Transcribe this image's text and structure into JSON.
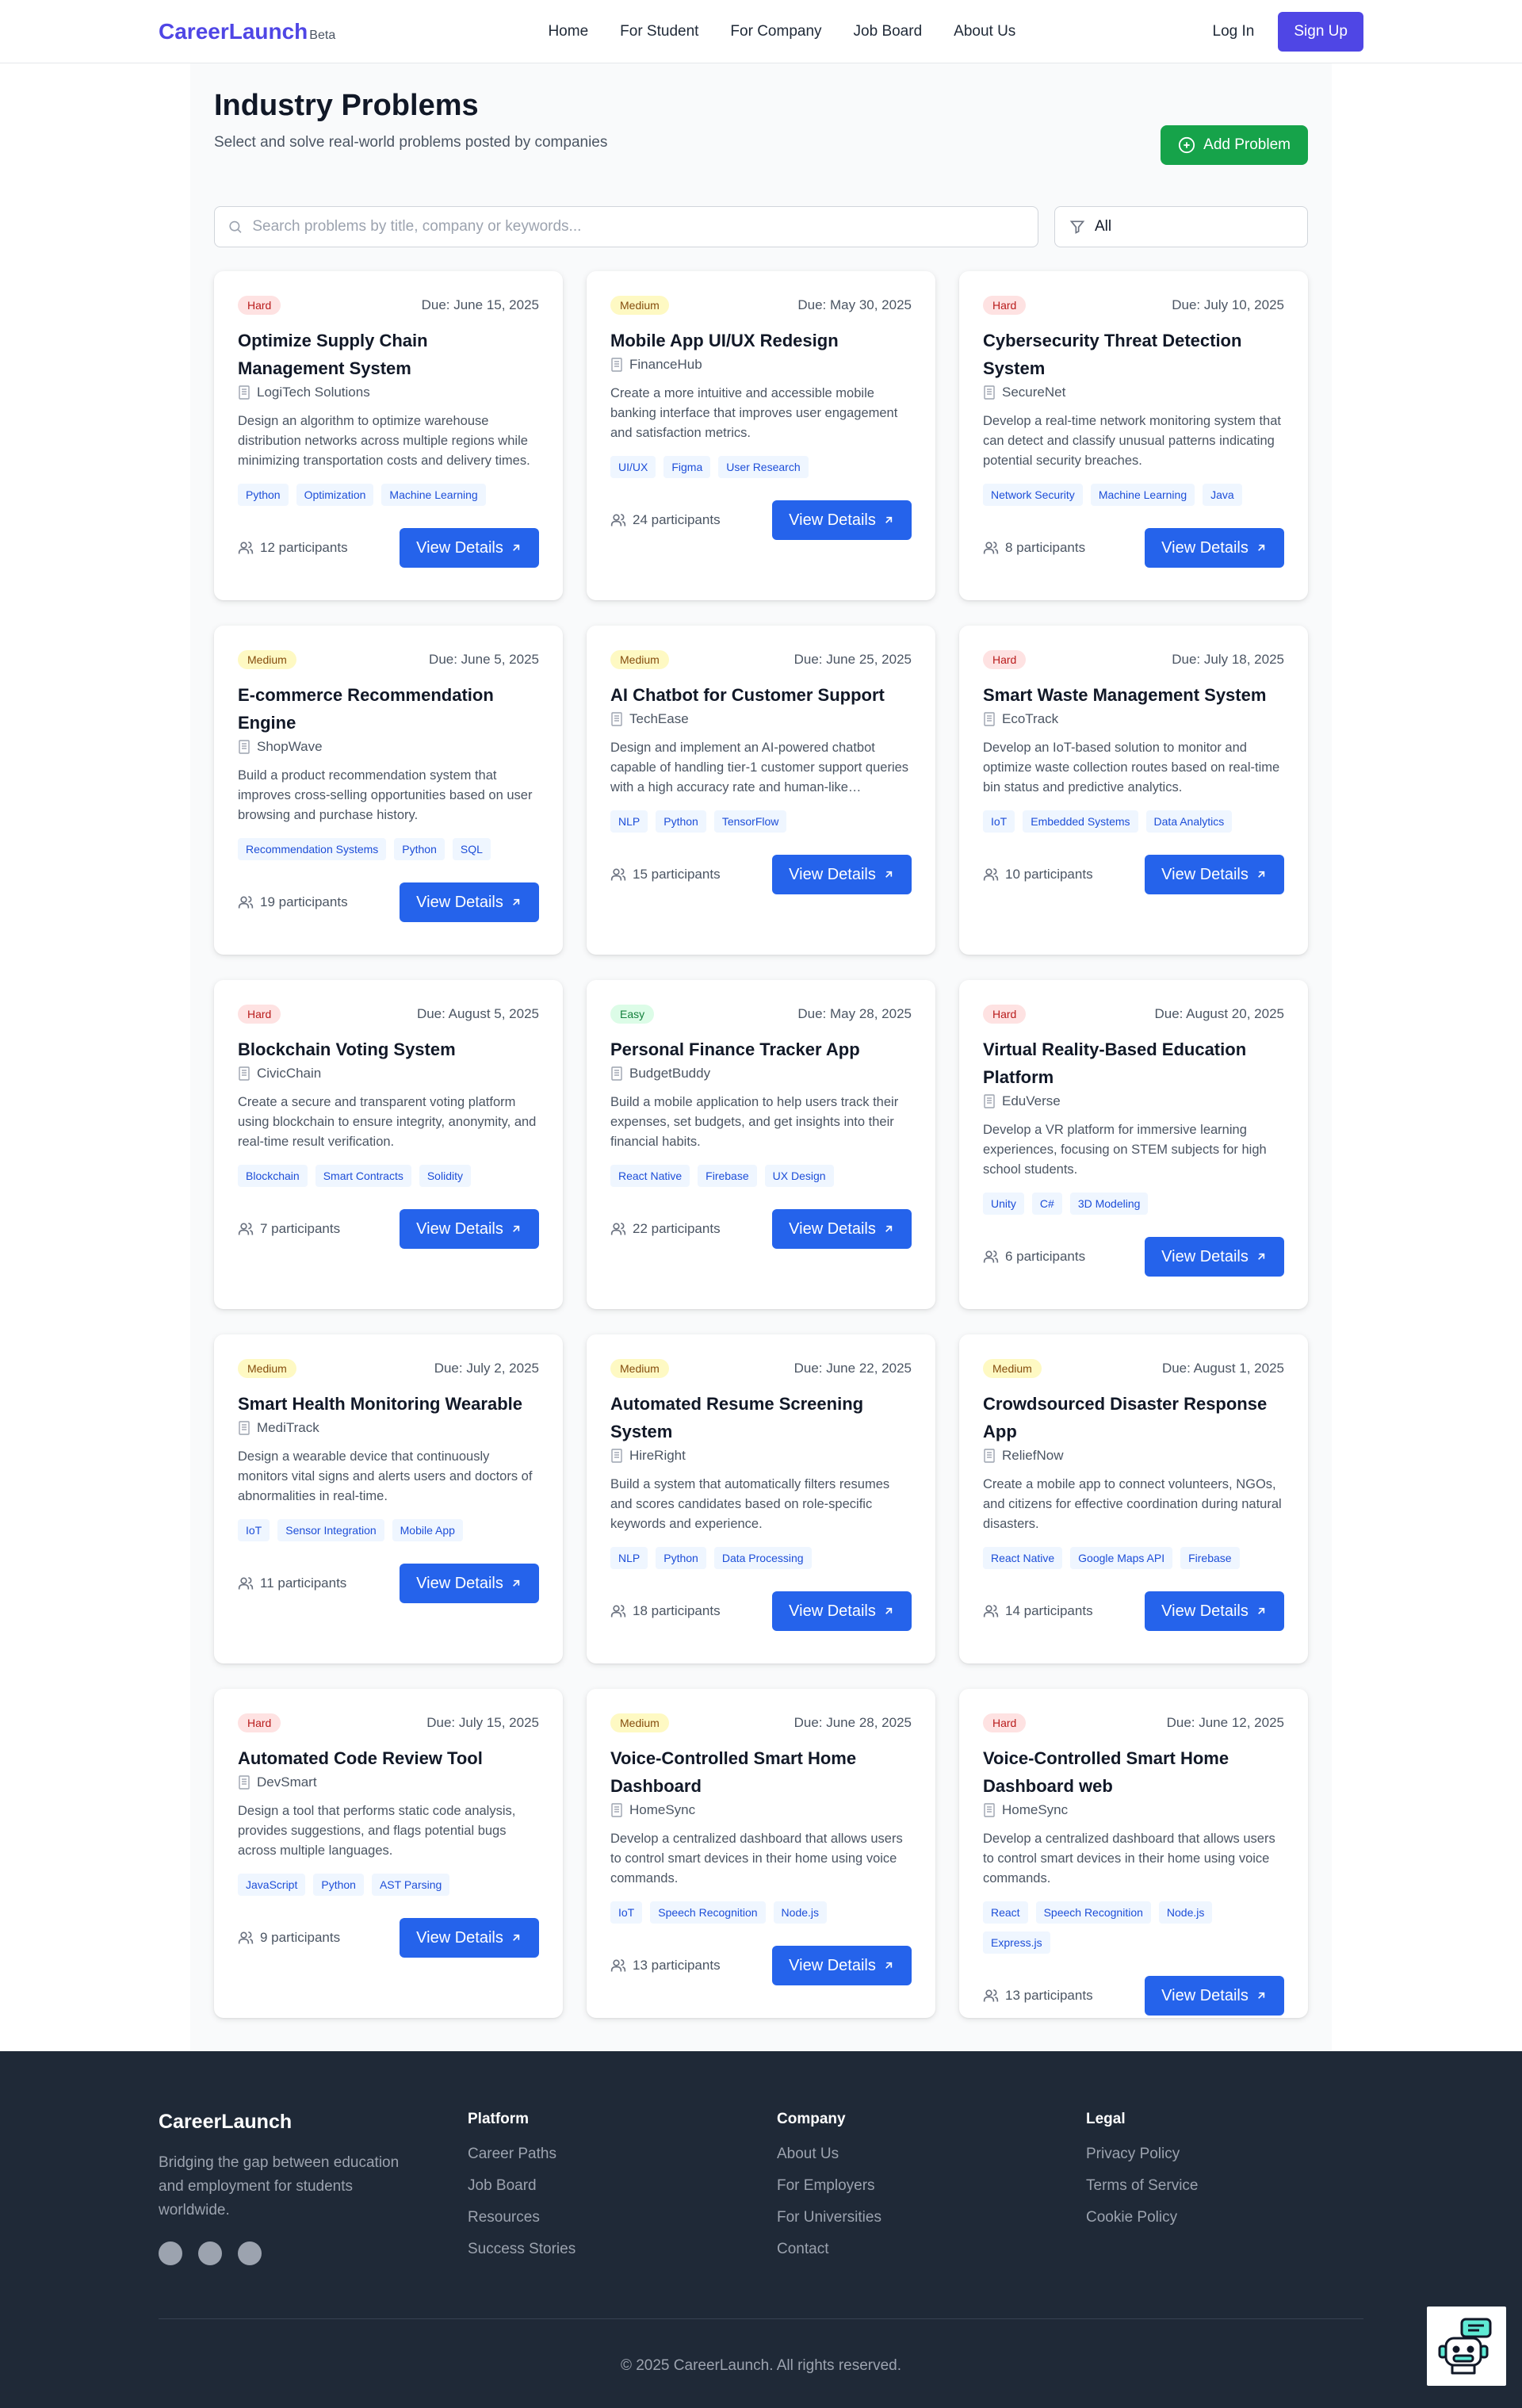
{
  "nav": {
    "brand": "CareerLaunch",
    "beta": "Beta",
    "links": [
      "Home",
      "For Student",
      "For Company",
      "Job Board",
      "About Us"
    ],
    "login": "Log In",
    "signup": "Sign Up"
  },
  "header": {
    "title": "Industry Problems",
    "subtitle": "Select and solve real-world problems posted by companies",
    "add_button": "Add Problem"
  },
  "search": {
    "placeholder": "Search problems by title, company or keywords...",
    "filter_value": "All"
  },
  "problems": [
    {
      "difficulty": "Hard",
      "due": "Due: June 15, 2025",
      "title": "Optimize Supply Chain Management System",
      "company": "LogiTech Solutions",
      "description": "Design an algorithm to optimize warehouse distribution networks across multiple regions while minimizing transportation costs and delivery times.",
      "tags": [
        "Python",
        "Optimization",
        "Machine Learning"
      ],
      "participants": "12 participants"
    },
    {
      "difficulty": "Medium",
      "due": "Due: May 30, 2025",
      "title": "Mobile App UI/UX Redesign",
      "company": "FinanceHub",
      "description": "Create a more intuitive and accessible mobile banking interface that improves user engagement and satisfaction metrics.",
      "tags": [
        "UI/UX",
        "Figma",
        "User Research"
      ],
      "participants": "24 participants"
    },
    {
      "difficulty": "Hard",
      "due": "Due: July 10, 2025",
      "title": "Cybersecurity Threat Detection System",
      "company": "SecureNet",
      "description": "Develop a real-time network monitoring system that can detect and classify unusual patterns indicating potential security breaches.",
      "tags": [
        "Network Security",
        "Machine Learning",
        "Java"
      ],
      "participants": "8 participants"
    },
    {
      "difficulty": "Medium",
      "due": "Due: June 5, 2025",
      "title": "E-commerce Recommendation Engine",
      "company": "ShopWave",
      "description": "Build a product recommendation system that improves cross-selling opportunities based on user browsing and purchase history.",
      "tags": [
        "Recommendation Systems",
        "Python",
        "SQL"
      ],
      "participants": "19 participants"
    },
    {
      "difficulty": "Medium",
      "due": "Due: June 25, 2025",
      "title": "AI Chatbot for Customer Support",
      "company": "TechEase",
      "description": "Design and implement an AI-powered chatbot capable of handling tier-1 customer support queries with a high accuracy rate and human-like responses.",
      "tags": [
        "NLP",
        "Python",
        "TensorFlow"
      ],
      "participants": "15 participants"
    },
    {
      "difficulty": "Hard",
      "due": "Due: July 18, 2025",
      "title": "Smart Waste Management System",
      "company": "EcoTrack",
      "description": "Develop an IoT-based solution to monitor and optimize waste collection routes based on real-time bin status and predictive analytics.",
      "tags": [
        "IoT",
        "Embedded Systems",
        "Data Analytics"
      ],
      "participants": "10 participants"
    },
    {
      "difficulty": "Hard",
      "due": "Due: August 5, 2025",
      "title": "Blockchain Voting System",
      "company": "CivicChain",
      "description": "Create a secure and transparent voting platform using blockchain to ensure integrity, anonymity, and real-time result verification.",
      "tags": [
        "Blockchain",
        "Smart Contracts",
        "Solidity"
      ],
      "participants": "7 participants"
    },
    {
      "difficulty": "Easy",
      "due": "Due: May 28, 2025",
      "title": "Personal Finance Tracker App",
      "company": "BudgetBuddy",
      "description": "Build a mobile application to help users track their expenses, set budgets, and get insights into their financial habits.",
      "tags": [
        "React Native",
        "Firebase",
        "UX Design"
      ],
      "participants": "22 participants"
    },
    {
      "difficulty": "Hard",
      "due": "Due: August 20, 2025",
      "title": "Virtual Reality-Based Education Platform",
      "company": "EduVerse",
      "description": "Develop a VR platform for immersive learning experiences, focusing on STEM subjects for high school students.",
      "tags": [
        "Unity",
        "C#",
        "3D Modeling"
      ],
      "participants": "6 participants"
    },
    {
      "difficulty": "Medium",
      "due": "Due: July 2, 2025",
      "title": "Smart Health Monitoring Wearable",
      "company": "MediTrack",
      "description": "Design a wearable device that continuously monitors vital signs and alerts users and doctors of abnormalities in real-time.",
      "tags": [
        "IoT",
        "Sensor Integration",
        "Mobile App"
      ],
      "participants": "11 participants"
    },
    {
      "difficulty": "Medium",
      "due": "Due: June 22, 2025",
      "title": "Automated Resume Screening System",
      "company": "HireRight",
      "description": "Build a system that automatically filters resumes and scores candidates based on role-specific keywords and experience.",
      "tags": [
        "NLP",
        "Python",
        "Data Processing"
      ],
      "participants": "18 participants"
    },
    {
      "difficulty": "Medium",
      "due": "Due: August 1, 2025",
      "title": "Crowdsourced Disaster Response App",
      "company": "ReliefNow",
      "description": "Create a mobile app to connect volunteers, NGOs, and citizens for effective coordination during natural disasters.",
      "tags": [
        "React Native",
        "Google Maps API",
        "Firebase"
      ],
      "participants": "14 participants"
    },
    {
      "difficulty": "Hard",
      "due": "Due: July 15, 2025",
      "title": "Automated Code Review Tool",
      "company": "DevSmart",
      "description": "Design a tool that performs static code analysis, provides suggestions, and flags potential bugs across multiple languages.",
      "tags": [
        "JavaScript",
        "Python",
        "AST Parsing"
      ],
      "participants": "9 participants"
    },
    {
      "difficulty": "Medium",
      "due": "Due: June 28, 2025",
      "title": "Voice-Controlled Smart Home Dashboard",
      "company": "HomeSync",
      "description": "Develop a centralized dashboard that allows users to control smart devices in their home using voice commands.",
      "tags": [
        "IoT",
        "Speech Recognition",
        "Node.js"
      ],
      "participants": "13 participants"
    },
    {
      "difficulty": "Hard",
      "due": "Due: June 12, 2025",
      "title": "Voice-Controlled Smart Home Dashboard web",
      "company": "HomeSync",
      "description": "Develop a centralized dashboard that allows users to control smart devices in their home using voice commands.",
      "tags": [
        "React",
        "Speech Recognition",
        "Node.js",
        "Express.js"
      ],
      "participants": "13 participants"
    }
  ],
  "view_details_label": "View Details",
  "footer": {
    "brand": "CareerLaunch",
    "tagline": "Bridging the gap between education and employment for students worldwide.",
    "platform": {
      "heading": "Platform",
      "links": [
        "Career Paths",
        "Job Board",
        "Resources",
        "Success Stories"
      ]
    },
    "company": {
      "heading": "Company",
      "links": [
        "About Us",
        "For Employers",
        "For Universities",
        "Contact"
      ]
    },
    "legal": {
      "heading": "Legal",
      "links": [
        "Privacy Policy",
        "Terms of Service",
        "Cookie Policy"
      ]
    },
    "copyright": "© 2025 CareerLaunch. All rights reserved."
  },
  "colors": {
    "brand": "#4f46e5",
    "primary_button": "#2563eb",
    "add_button": "#16a34a",
    "footer_bg": "#1f2937"
  },
  "icons": {
    "search": "search-icon",
    "filter": "filter-icon",
    "add": "plus-circle-icon",
    "company": "building-icon",
    "participants": "users-icon",
    "view": "arrow-up-right-icon",
    "chat": "chatbot-icon"
  }
}
